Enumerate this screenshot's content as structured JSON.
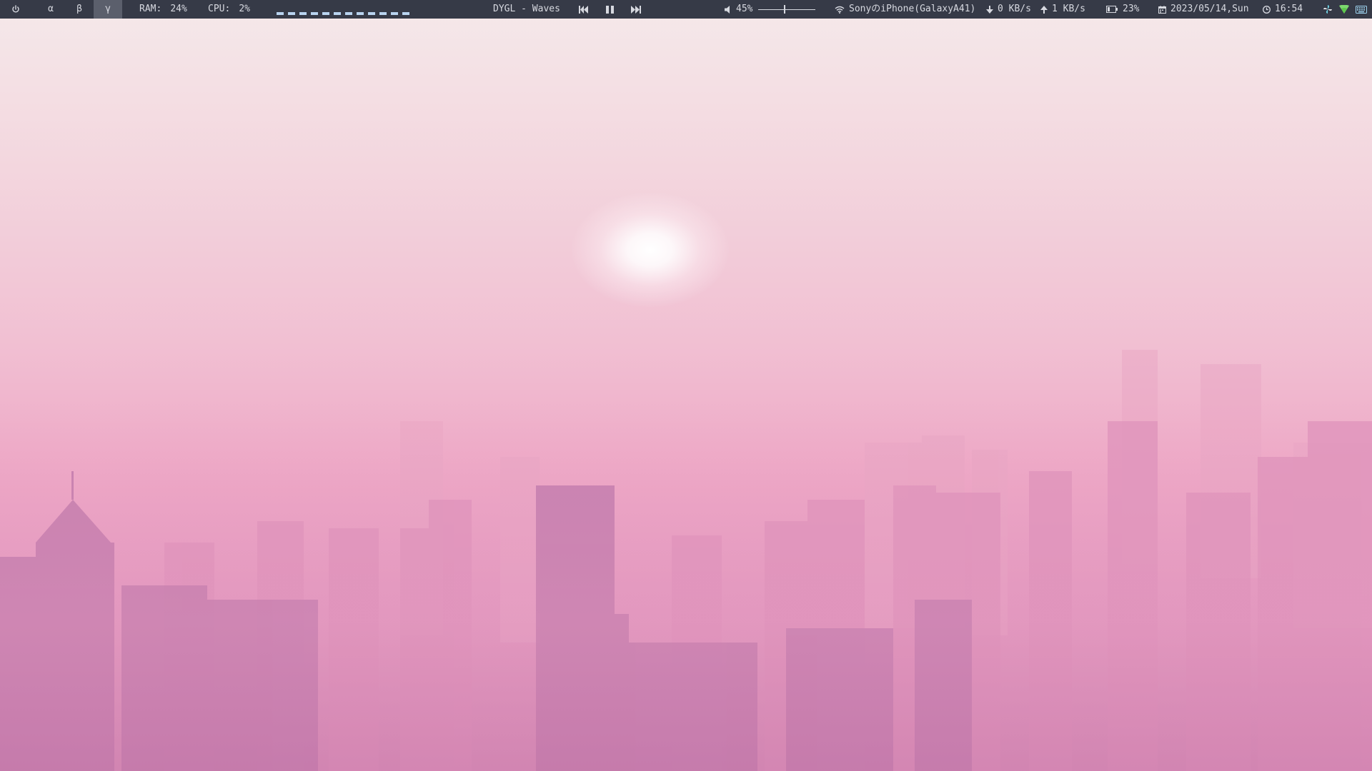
{
  "topbar": {
    "power_icon": "power-icon",
    "workspaces": [
      {
        "label": "α",
        "active": false
      },
      {
        "label": "β",
        "active": false
      },
      {
        "label": "γ",
        "active": true
      }
    ],
    "ram": {
      "label": "RAM:",
      "value": "24%"
    },
    "cpu": {
      "label": "CPU:",
      "value": "2%"
    },
    "visualizer_bars": 12,
    "visualizer_color": "#b9d4f0",
    "media": {
      "title": "DYGL - Waves",
      "prev_icon": "skip-back-icon",
      "pause_icon": "pause-icon",
      "next_icon": "skip-forward-icon"
    },
    "volume": {
      "icon": "speaker-icon",
      "value": "45%",
      "level": 0.45
    },
    "wifi": {
      "icon": "wifi-icon",
      "ssid": "SonyのiPhone(GalaxyA41)"
    },
    "network": {
      "down_icon": "arrow-down-icon",
      "down": "0 KB/s",
      "up_icon": "arrow-up-icon",
      "up": "1 KB/s"
    },
    "battery": {
      "icon": "battery-icon",
      "value": "23%"
    },
    "date": {
      "icon": "calendar-icon",
      "value": "2023/05/14,Sun"
    },
    "time": {
      "icon": "clock-icon",
      "value": "16:54"
    },
    "tray": [
      "pinwheel-icon",
      "network-tray-icon",
      "keyboard-icon"
    ]
  },
  "colors": {
    "bar_bg": "#363a47",
    "bar_text": "#d7d9e0",
    "active_workspace": "#5b5f6c",
    "sky_top": "#f5e9ea",
    "sky_bottom": "#d98fb8"
  }
}
